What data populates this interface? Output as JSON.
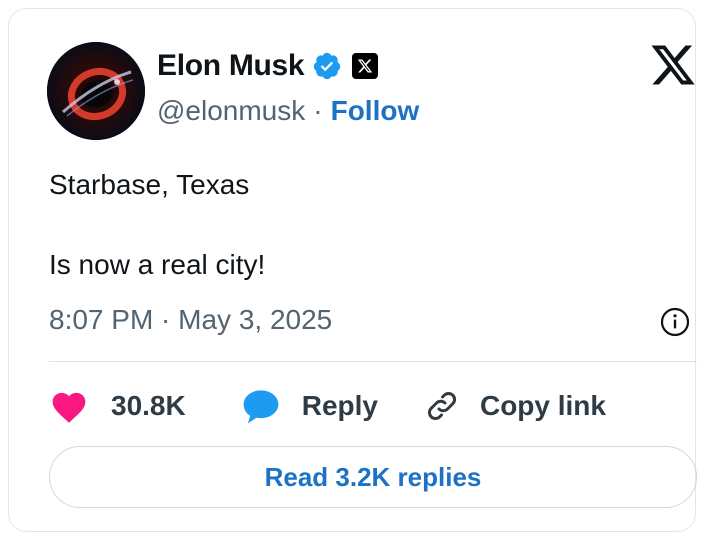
{
  "author": {
    "name": "Elon Musk",
    "handle": "@elonmusk",
    "separator": "·",
    "follow_label": "Follow"
  },
  "tweet": {
    "line1": "Starbase, Texas",
    "line2": "Is now a real city!",
    "timestamp": "8:07 PM · May 3, 2025"
  },
  "actions": {
    "likes_count": "30.8K",
    "reply_label": "Reply",
    "copy_link_label": "Copy link",
    "read_replies_label": "Read 3.2K replies"
  },
  "icons": {
    "logo": "x-logo-icon",
    "verified": "verified-badge-icon",
    "affiliate": "x-affiliate-badge-icon",
    "info": "info-icon",
    "like": "heart-icon",
    "reply": "speech-bubble-icon",
    "copy": "link-icon"
  },
  "colors": {
    "accent": "#1d72c4",
    "verified": "#1d9bf0",
    "like": "#f91880",
    "reply": "#1d9bf0",
    "text": "#0f1419",
    "muted": "#536471"
  }
}
